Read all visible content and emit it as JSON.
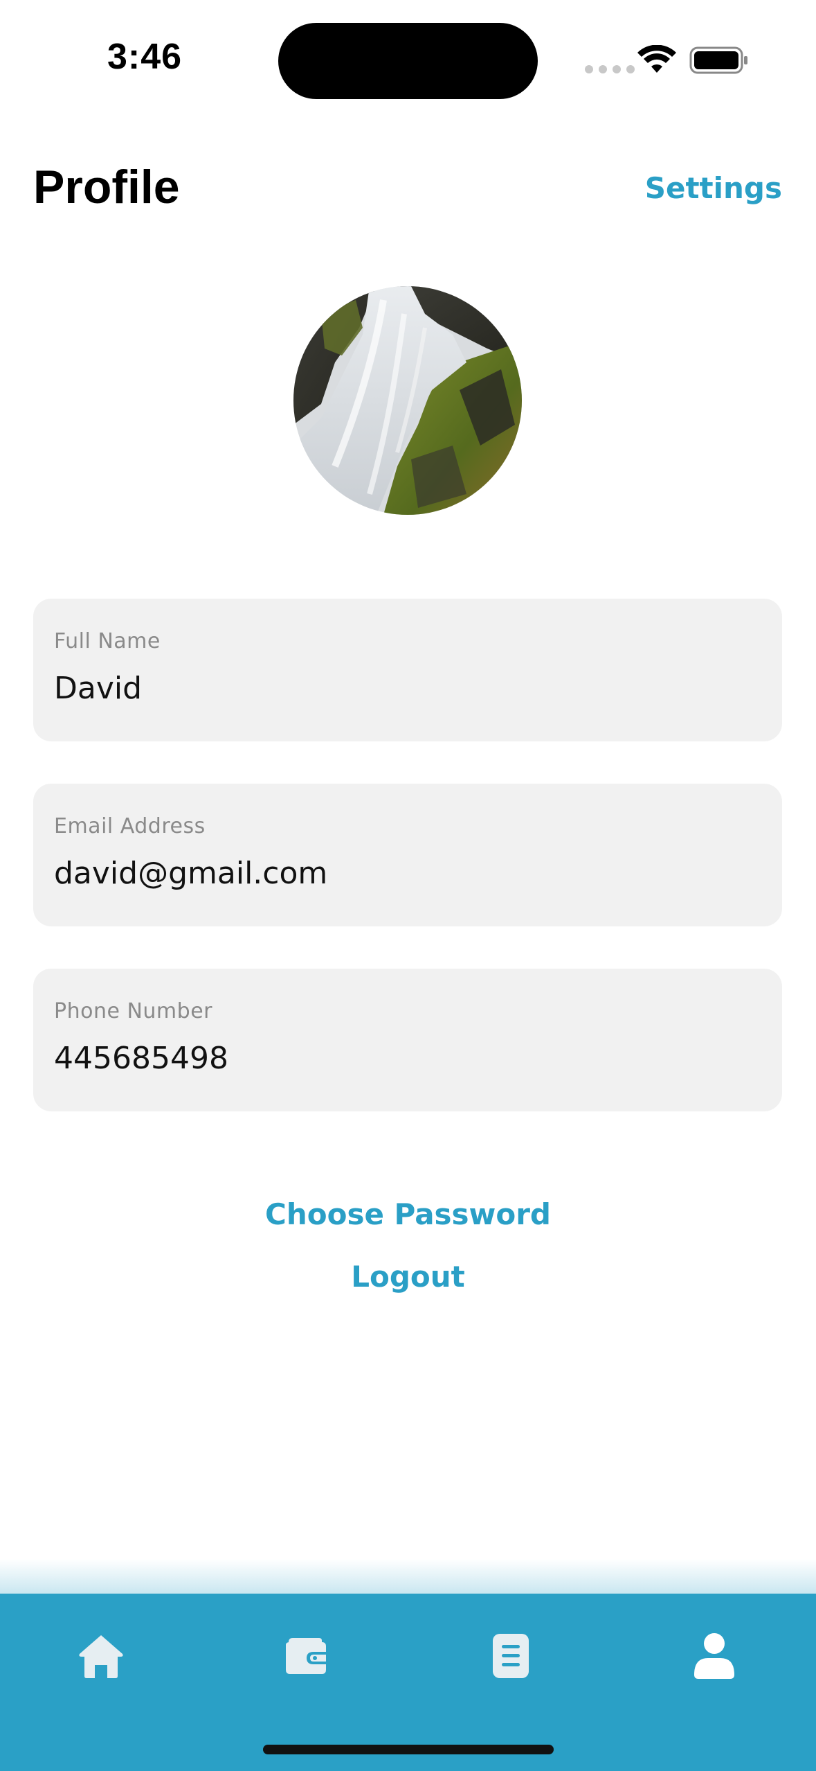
{
  "status_bar": {
    "time": "3:46"
  },
  "header": {
    "title": "Profile",
    "settings_label": "Settings"
  },
  "avatar": {
    "description_icon": "waterfall-photo"
  },
  "fields": [
    {
      "label": "Full Name",
      "value": "David"
    },
    {
      "label": "Email Address",
      "value": "david@gmail.com"
    },
    {
      "label": "Phone Number",
      "value": "445685498"
    }
  ],
  "actions": {
    "choose_password": "Choose Password",
    "logout": "Logout"
  },
  "tab_bar": {
    "items": [
      {
        "icon": "home-icon"
      },
      {
        "icon": "wallet-icon"
      },
      {
        "icon": "document-icon"
      },
      {
        "icon": "user-icon"
      }
    ],
    "active_index": 3
  },
  "colors": {
    "accent": "#2a9fc6",
    "field_bg": "#f1f1f1",
    "tab_bar_bg": "#2aa0c6",
    "inactive_icon": "#e6eef2"
  }
}
